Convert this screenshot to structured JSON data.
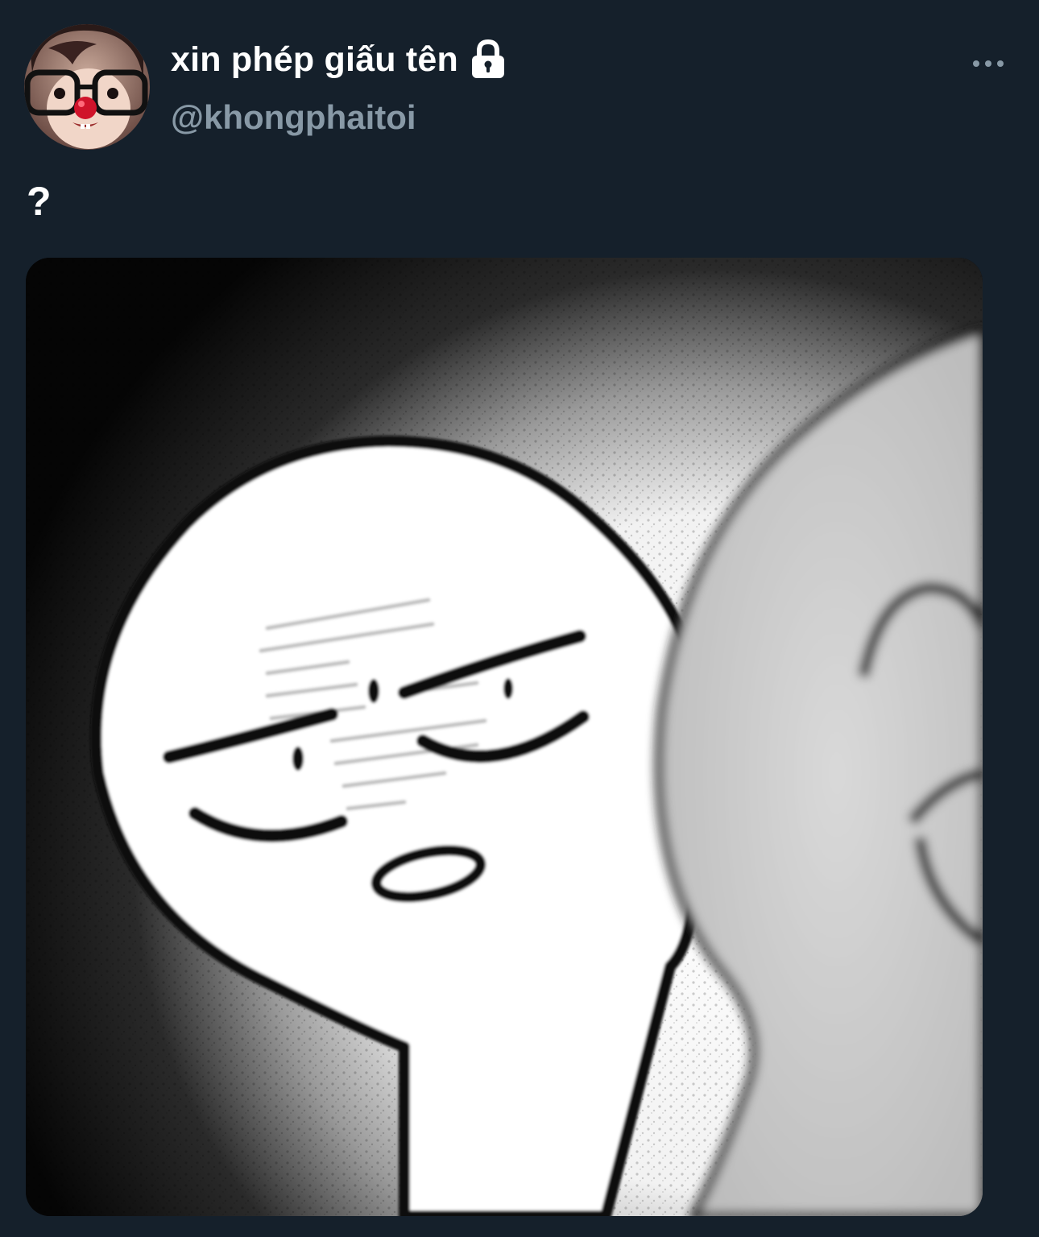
{
  "tweet": {
    "display_name": "xin phép giấu tên",
    "handle": "@khongphaitoi",
    "text": "?",
    "protected_account_icon": "lock-icon",
    "more_options_icon": "more-horizontal-icon",
    "media": {
      "description": "meme"
    }
  },
  "colors": {
    "background": "#15202b",
    "primary_text": "#ffffff",
    "secondary_text": "#8899a6"
  }
}
